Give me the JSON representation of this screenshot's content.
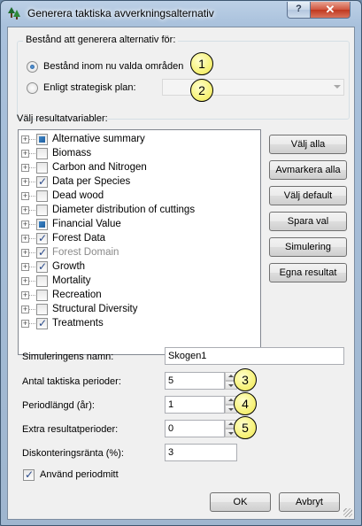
{
  "window": {
    "title": "Generera taktiska avverkningsalternativ",
    "help_label": "?",
    "close_label": "✕",
    "app_icon": "tree-icon"
  },
  "group": {
    "title": "Bestånd att generera alternativ för:",
    "option_selected_areas": "Bestånd inom nu valda områden",
    "option_strategic_plan": "Enligt strategisk plan:",
    "selected_option": "Bestånd inom nu valda områden",
    "strategic_plan_value": ""
  },
  "callouts": [
    "1",
    "2",
    "3",
    "4",
    "5"
  ],
  "result_variables": {
    "label": "Välj resultatvariabler:",
    "items": [
      {
        "label": "Alternative summary",
        "state": "partial",
        "enabled": true
      },
      {
        "label": "Biomass",
        "state": "unchecked",
        "enabled": true
      },
      {
        "label": "Carbon and Nitrogen",
        "state": "unchecked",
        "enabled": true
      },
      {
        "label": "Data per Species",
        "state": "checked",
        "enabled": true
      },
      {
        "label": "Dead wood",
        "state": "unchecked",
        "enabled": true
      },
      {
        "label": "Diameter distribution of cuttings",
        "state": "unchecked",
        "enabled": true
      },
      {
        "label": "Financial Value",
        "state": "partial",
        "enabled": true
      },
      {
        "label": "Forest Data",
        "state": "checked",
        "enabled": true
      },
      {
        "label": "Forest Domain",
        "state": "checked",
        "enabled": false
      },
      {
        "label": "Growth",
        "state": "checked",
        "enabled": true
      },
      {
        "label": "Mortality",
        "state": "unchecked",
        "enabled": true
      },
      {
        "label": "Recreation",
        "state": "unchecked",
        "enabled": true
      },
      {
        "label": "Structural Diversity",
        "state": "unchecked",
        "enabled": true
      },
      {
        "label": "Treatments",
        "state": "checked",
        "enabled": true
      }
    ]
  },
  "side_buttons": {
    "select_all": "Välj alla",
    "deselect_all": "Avmarkera alla",
    "select_default": "Välj default",
    "save_selection": "Spara val",
    "simulation": "Simulering",
    "own_results": "Egna resultat"
  },
  "fields": {
    "simulation_name_label": "Simuleringens namn:",
    "simulation_name_value": "Skogen1",
    "tactical_periods_label": "Antal taktiska perioder:",
    "tactical_periods_value": "5",
    "period_length_label": "Periodlängd (år):",
    "period_length_value": "1",
    "extra_periods_label": "Extra resultatperioder:",
    "extra_periods_value": "0",
    "discount_rate_label": "Diskonteringsränta (%):",
    "discount_rate_value": "3",
    "use_midpoint_label": "Använd periodmitt",
    "use_midpoint_checked": true
  },
  "footer": {
    "ok_label": "OK",
    "cancel_label": "Avbryt"
  },
  "colors": {
    "title_bar": "#a9c1dc",
    "close_button": "#c0381f",
    "callout_fill": "#f7f27a",
    "client_bg": "#f0f0f0"
  }
}
